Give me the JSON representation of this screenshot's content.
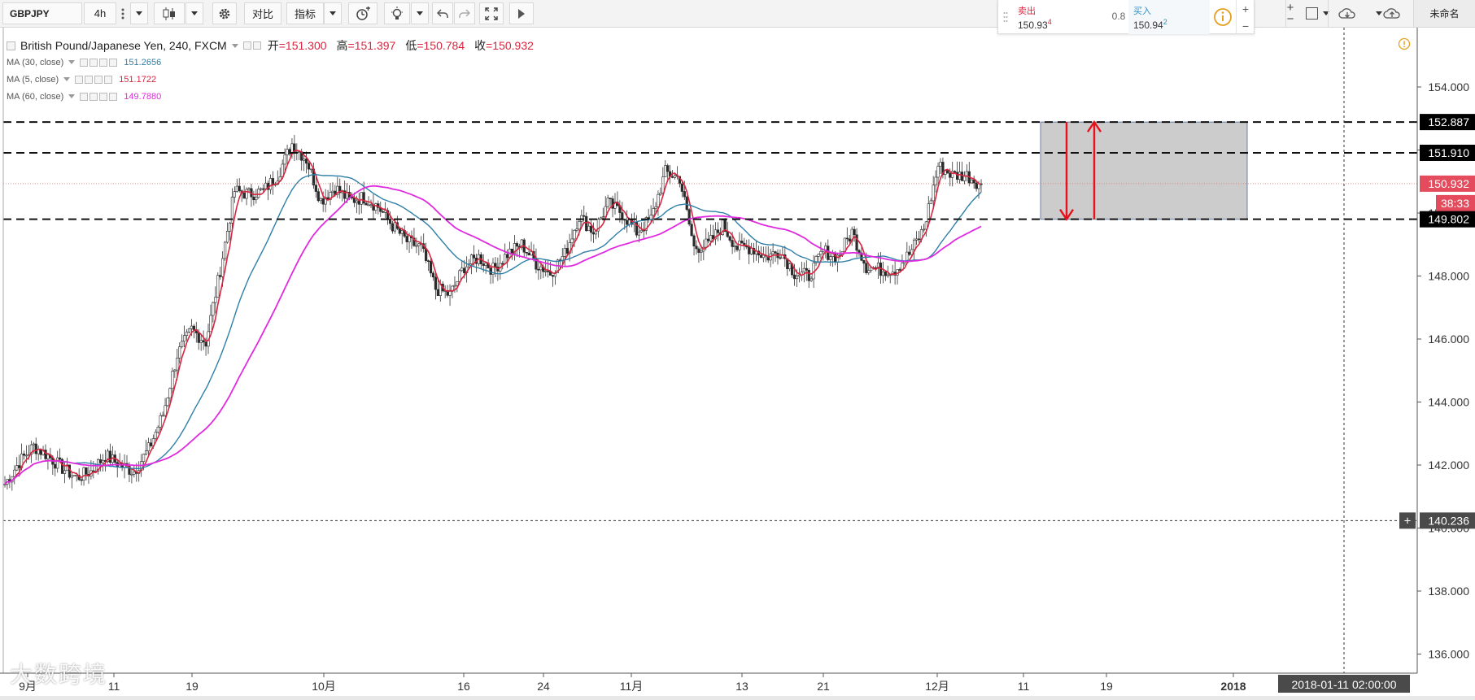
{
  "toolbar": {
    "symbol": "GBPJPY",
    "interval": "4h",
    "compare_label": "对比",
    "indicators_label": "指标",
    "layout_name": "未命名"
  },
  "trade": {
    "sell_label": "卖出",
    "sell_price_main": "150.93",
    "sell_price_sup": "4",
    "spread": "0.8",
    "buy_label": "买入",
    "buy_price_main": "150.94",
    "buy_price_sup": "2"
  },
  "legend": {
    "title": "British Pound/Japanese Yen, 240, FXCM",
    "open_label": "开",
    "open": "151.300",
    "high_label": "高",
    "high": "151.397",
    "low_label": "低",
    "low": "150.784",
    "close_label": "收",
    "close": "150.932",
    "ma": [
      {
        "label": "MA (30, close)",
        "value": "151.2656",
        "color": "#2e7fa8"
      },
      {
        "label": "MA (5, close)",
        "value": "151.1722",
        "color": "#d9253f"
      },
      {
        "label": "MA (60, close)",
        "value": "149.7880",
        "color": "#e02ae0"
      }
    ]
  },
  "price_axis": {
    "ticks": [
      "154.000",
      "152.000",
      "150.000",
      "148.000",
      "146.000",
      "144.000",
      "142.000",
      "140.000",
      "138.000",
      "136.000"
    ],
    "levels": [
      {
        "value": "152.887",
        "style": "dark"
      },
      {
        "value": "151.910",
        "style": "dark"
      },
      {
        "value": "150.932",
        "style": "red"
      },
      {
        "value": "38:33",
        "style": "red"
      },
      {
        "value": "149.802",
        "style": "dark"
      },
      {
        "value": "140.236",
        "style": "crosshair"
      }
    ]
  },
  "time_axis": {
    "ticks": [
      "9月",
      "11",
      "19",
      "10月",
      "16",
      "24",
      "11月",
      "13",
      "21",
      "12月",
      "11",
      "19",
      "2018"
    ],
    "crosshair_label": "2018-01-11 02:00:00"
  },
  "chart_data": {
    "type": "candlestick",
    "symbol": "GBPJPY",
    "ylim": [
      135.5,
      155.2
    ],
    "horizontal_levels": [
      152.887,
      151.91,
      149.802
    ],
    "last_price": 150.932,
    "crosshair_price": 140.236,
    "series": [
      {
        "name": "MA (5, close)",
        "color": "#d9253f"
      },
      {
        "name": "MA (30, close)",
        "color": "#2e7fa8"
      },
      {
        "name": "MA (60, close)",
        "color": "#e02ae0"
      }
    ],
    "close_path_approx": [
      141.4,
      142.1,
      142.6,
      142.3,
      141.9,
      141.6,
      141.8,
      142.3,
      142.0,
      141.8,
      142.5,
      143.6,
      145.5,
      146.3,
      145.9,
      148.2,
      150.7,
      150.6,
      150.7,
      151.2,
      152.2,
      151.7,
      150.4,
      150.8,
      150.4,
      150.5,
      150.2,
      149.6,
      149.1,
      148.9,
      147.6,
      147.4,
      148.3,
      148.6,
      148.2,
      148.7,
      149.0,
      148.4,
      148.1,
      148.7,
      149.9,
      149.4,
      150.3,
      150.0,
      149.4,
      149.8,
      151.3,
      151.1,
      148.9,
      149.0,
      149.6,
      148.9,
      148.9,
      148.6,
      148.8,
      148.1,
      148.0,
      148.8,
      148.6,
      149.4,
      148.3,
      148.2,
      148.2,
      148.7,
      149.5,
      151.5,
      151.2,
      151.2,
      150.9
    ]
  },
  "watermark": "大数跨境"
}
